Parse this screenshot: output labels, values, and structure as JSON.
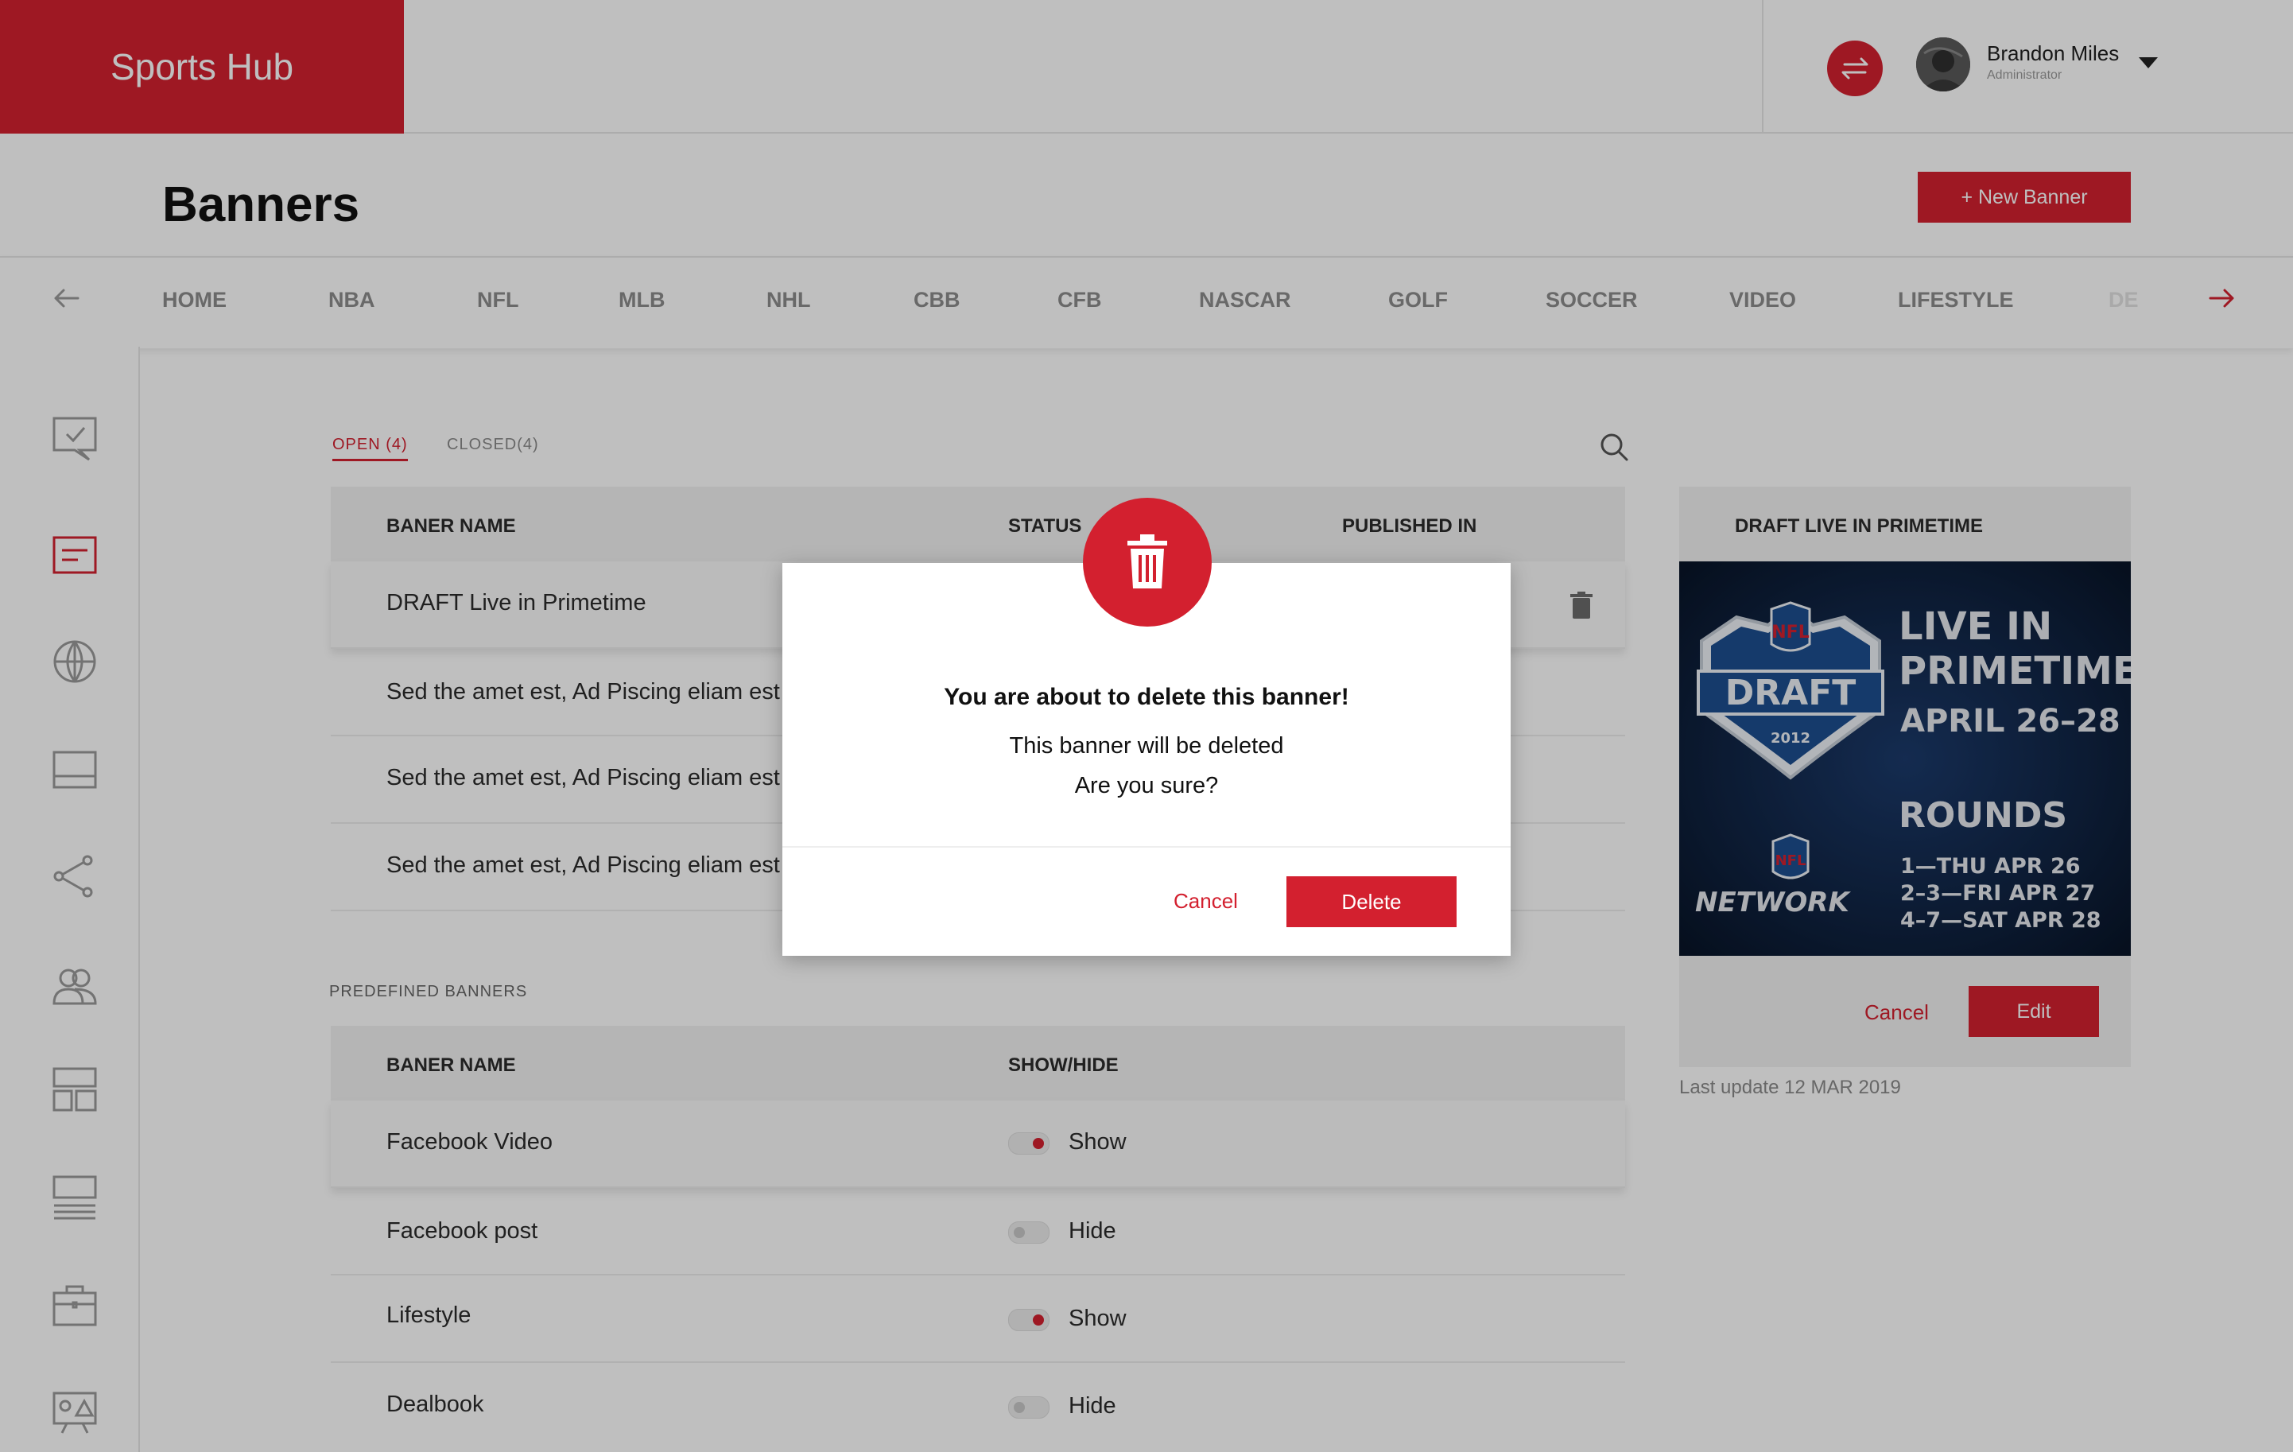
{
  "app": {
    "name": "Sports Hub"
  },
  "user": {
    "name": "Brandon Miles",
    "role": "Administrator"
  },
  "page": {
    "title": "Banners",
    "new_button": "+ New Banner"
  },
  "categories": [
    "HOME",
    "NBA",
    "NFL",
    "MLB",
    "NHL",
    "CBB",
    "CFB",
    "NASCAR",
    "GOLF",
    "SOCCER",
    "VIDEO",
    "LIFESTYLE",
    "DE"
  ],
  "tabs": {
    "open": "OPEN (4)",
    "closed": "CLOSED(4)"
  },
  "banners_table": {
    "headers": {
      "name": "BANER NAME",
      "status": "STATUS",
      "published": "PUBLISHED IN"
    },
    "rows": [
      {
        "name": "DRAFT Live in Primetime"
      },
      {
        "name": "Sed the amet est, Ad Piscing eliam est"
      },
      {
        "name": "Sed the amet est, Ad Piscing eliam est"
      },
      {
        "name": "Sed the amet est, Ad Piscing eliam est"
      }
    ]
  },
  "predefined": {
    "label": "PREDEFINED BANNERS",
    "headers": {
      "name": "BANER NAME",
      "show": "SHOW/HIDE"
    },
    "rows": [
      {
        "name": "Facebook Video",
        "state": "Show",
        "on": true
      },
      {
        "name": "Facebook post",
        "state": "Hide",
        "on": false
      },
      {
        "name": "Lifestyle",
        "state": "Show",
        "on": true
      },
      {
        "name": "Dealbook",
        "state": "Hide",
        "on": false
      }
    ]
  },
  "preview": {
    "title": "DRAFT LIVE IN PRIMETIME",
    "image_text": {
      "shield_word": "DRAFT",
      "shield_year": "2012",
      "headline1": "LIVE IN",
      "headline2": "PRIMETIME",
      "dates": "APRIL 26–28",
      "rounds": "ROUNDS",
      "r1": "1—THU APR 26",
      "r2": "2–3—FRI APR 27",
      "r3": "4–7—SAT APR 28",
      "network": "NETWORK",
      "nfl": "NFL"
    },
    "cancel": "Cancel",
    "edit": "Edit",
    "last_update": "Last update 12 MAR 2019"
  },
  "modal": {
    "heading": "You are about to delete this banner!",
    "line1": "This banner will be deleted",
    "line2": "Are you sure?",
    "cancel": "Cancel",
    "delete": "Delete"
  },
  "colors": {
    "accent": "#d3202f",
    "overlay": "rgba(0,0,0,0.25)"
  },
  "icons": {
    "sidebar": [
      "chat-check-icon",
      "article-icon",
      "globe-icon",
      "layout-icon",
      "share-icon",
      "users-icon",
      "grid-icon",
      "list-icon",
      "briefcase-icon",
      "media-icon"
    ]
  }
}
